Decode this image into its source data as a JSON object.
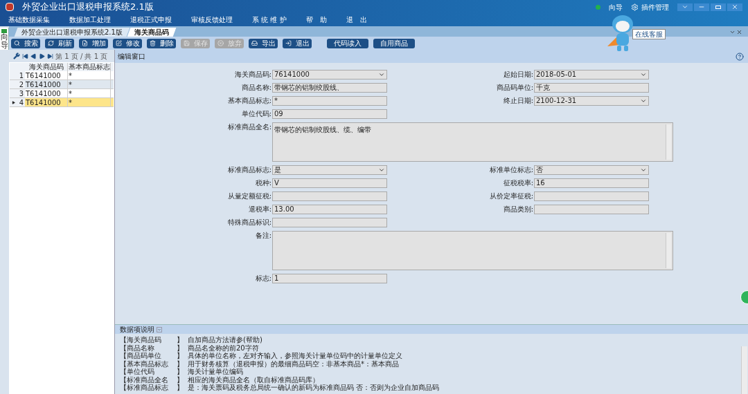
{
  "window": {
    "title": "外贸企业出口退税申报系统2.1版",
    "guide": "向导",
    "plugins": "插件管理"
  },
  "menu": [
    "基础数据采集",
    "数据加工处理",
    "退税正式申报",
    "审核反馈处理",
    "系 统 维 护",
    "帮　助",
    "退　出"
  ],
  "assistant": {
    "tooltip": "在线客服"
  },
  "side_tab": "向导",
  "tabs": [
    {
      "label": "外贸企业出口退税申报系统2.1版",
      "selected": false
    },
    {
      "label": "海关商品码",
      "selected": true
    }
  ],
  "toolbar": [
    {
      "label": "搜索",
      "disabled": false
    },
    {
      "label": "刷新",
      "disabled": false
    },
    {
      "label": "增加",
      "disabled": false
    },
    {
      "label": "修改",
      "disabled": false
    },
    {
      "label": "删除",
      "disabled": false
    },
    {
      "label": "保存",
      "disabled": true
    },
    {
      "label": "放弃",
      "disabled": true
    },
    {
      "label": "导出",
      "disabled": false
    },
    {
      "label": "退出",
      "disabled": false
    },
    {
      "label": "代码读入",
      "disabled": false
    },
    {
      "label": "自用商品",
      "disabled": false
    }
  ],
  "list": {
    "pager": "第 1 页 / 共 1 页",
    "columns": [
      "海关商品码",
      "基本商品标志"
    ],
    "rows": [
      {
        "num": "1",
        "cells": [
          "T6141000",
          "*"
        ],
        "selected": false
      },
      {
        "num": "2",
        "cells": [
          "T6141000",
          "*"
        ],
        "selected": false
      },
      {
        "num": "3",
        "cells": [
          "T6141000",
          "*"
        ],
        "selected": false
      },
      {
        "num": "4",
        "cells": [
          "T6141000",
          "*"
        ],
        "selected": true
      }
    ]
  },
  "editor": {
    "title": "编辑窗口",
    "rows": [
      [
        {
          "label": "海关商品码:",
          "kind": "select",
          "value": "76141000"
        },
        {
          "label": "起始日期:",
          "kind": "select",
          "value": "2018-05-01"
        }
      ],
      [
        {
          "label": "商品名称:",
          "kind": "text",
          "value": "带钢芯的铝制绞股线、"
        },
        {
          "label": "商品码单位:",
          "kind": "text",
          "value": "千克"
        }
      ],
      [
        {
          "label": "基本商品标志:",
          "kind": "text",
          "value": "*"
        },
        {
          "label": "终止日期:",
          "kind": "select",
          "value": "2100-12-31"
        }
      ],
      [
        {
          "label": "单位代码:",
          "kind": "text",
          "value": "09"
        }
      ],
      [
        {
          "label": "标准商品全名:",
          "kind": "textarea",
          "value": "带钢芯的铝制绞股线、缆、编带"
        }
      ],
      [
        {
          "label": "标准商品标志:",
          "kind": "select",
          "value": "是"
        },
        {
          "label": "标准单位标志:",
          "kind": "select",
          "value": "否"
        }
      ],
      [
        {
          "label": "税种:",
          "kind": "text",
          "value": "V"
        },
        {
          "label": "征税税率:",
          "kind": "text",
          "value": "16"
        }
      ],
      [
        {
          "label": "从量定额征税:",
          "kind": "text"
        },
        {
          "label": "从价定率征税:",
          "kind": "text"
        }
      ],
      [
        {
          "label": "退税率:",
          "kind": "text",
          "value": "13.00"
        },
        {
          "label": "商品类别:",
          "kind": "text"
        }
      ],
      [
        {
          "label": "特殊商品标识:",
          "kind": "text"
        }
      ],
      [
        {
          "label": "备注:",
          "kind": "textarea"
        }
      ],
      [
        {
          "label": "标志:",
          "kind": "text",
          "value": "1"
        }
      ]
    ]
  },
  "help": {
    "title": "数据项说明",
    "rows": [
      {
        "name": "【海关商品码",
        "close": "】",
        "text": "自加商品方法请参(帮助)"
      },
      {
        "name": "【商品名称",
        "close": "】",
        "text": "商品名全称的前20字符"
      },
      {
        "name": "【商品码单位",
        "close": "】",
        "text": "具体的单位名称，左对齐输入，参照海关计量单位码中的计量单位定义"
      },
      {
        "name": "【基本商品标志",
        "close": "】",
        "text": "用于财务核算（退税申报）的最细商品码空：非基本商品*：基本商品"
      },
      {
        "name": "【单位代码",
        "close": "】",
        "text": "海关计量单位编码"
      },
      {
        "name": "【标准商品全名",
        "close": "】",
        "text": "相应的海关商品全名（取自标准商品码库）"
      },
      {
        "name": "【标准商品标志",
        "close": "】",
        "text": "是：海关票码及税务总局统一确认的新码为标准商品码 否：否则为企业自加商品码"
      }
    ]
  }
}
